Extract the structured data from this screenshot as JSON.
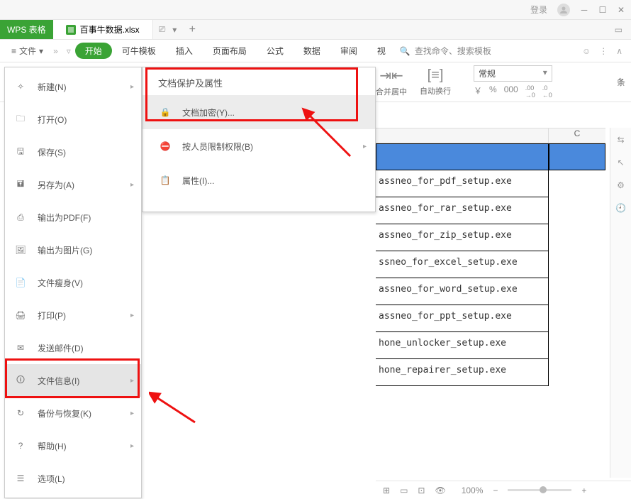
{
  "titlebar": {
    "login": "登录"
  },
  "tabs": {
    "app_name": "WPS 表格",
    "document_name": "百事牛数据.xlsx",
    "plus": "+"
  },
  "ribbon": {
    "file_label": "文件",
    "start": "开始",
    "tabs": [
      "可牛模板",
      "插入",
      "页面布局",
      "公式",
      "数据",
      "审阅",
      "视"
    ],
    "search_placeholder": "查找命令、搜索模板",
    "group_merge": "合并居中",
    "group_wrap": "自动换行",
    "format_label": "常规",
    "currency": "￥",
    "percent": "%",
    "dec1": "000",
    "dec2": ".00\n→0",
    "dec3": ".0\n←0",
    "cond": "条"
  },
  "file_menu": {
    "items": [
      {
        "label": "新建(N)",
        "has_sub": true
      },
      {
        "label": "打开(O)",
        "has_sub": false
      },
      {
        "label": "保存(S)",
        "has_sub": false
      },
      {
        "label": "另存为(A)",
        "has_sub": true
      },
      {
        "label": "输出为PDF(F)",
        "has_sub": false
      },
      {
        "label": "输出为图片(G)",
        "has_sub": false
      },
      {
        "label": "文件瘦身(V)",
        "has_sub": false
      },
      {
        "label": "打印(P)",
        "has_sub": true
      },
      {
        "label": "发送邮件(D)",
        "has_sub": false
      },
      {
        "label": "文件信息(I)",
        "has_sub": true,
        "selected": true
      },
      {
        "label": "备份与恢复(K)",
        "has_sub": true
      },
      {
        "label": "帮助(H)",
        "has_sub": true
      },
      {
        "label": "选项(L)",
        "has_sub": false
      }
    ]
  },
  "submenu": {
    "header": "文档保护及属性",
    "items": [
      {
        "label": "文档加密(Y)...",
        "highlight": true
      },
      {
        "label": "按人员限制权限(B)",
        "has_sub": true
      },
      {
        "label": "属性(I)..."
      }
    ]
  },
  "sheet": {
    "col_c_header": "C",
    "rows": [
      "assneo_for_pdf_setup.exe",
      "assneo_for_rar_setup.exe",
      "assneo_for_zip_setup.exe",
      "ssneo_for_excel_setup.exe",
      "assneo_for_word_setup.exe",
      "assneo_for_ppt_setup.exe",
      "hone_unlocker_setup.exe",
      "hone_repairer_setup.exe"
    ]
  },
  "statusbar": {
    "zoom": "100%",
    "minus": "−",
    "plus": "+"
  }
}
